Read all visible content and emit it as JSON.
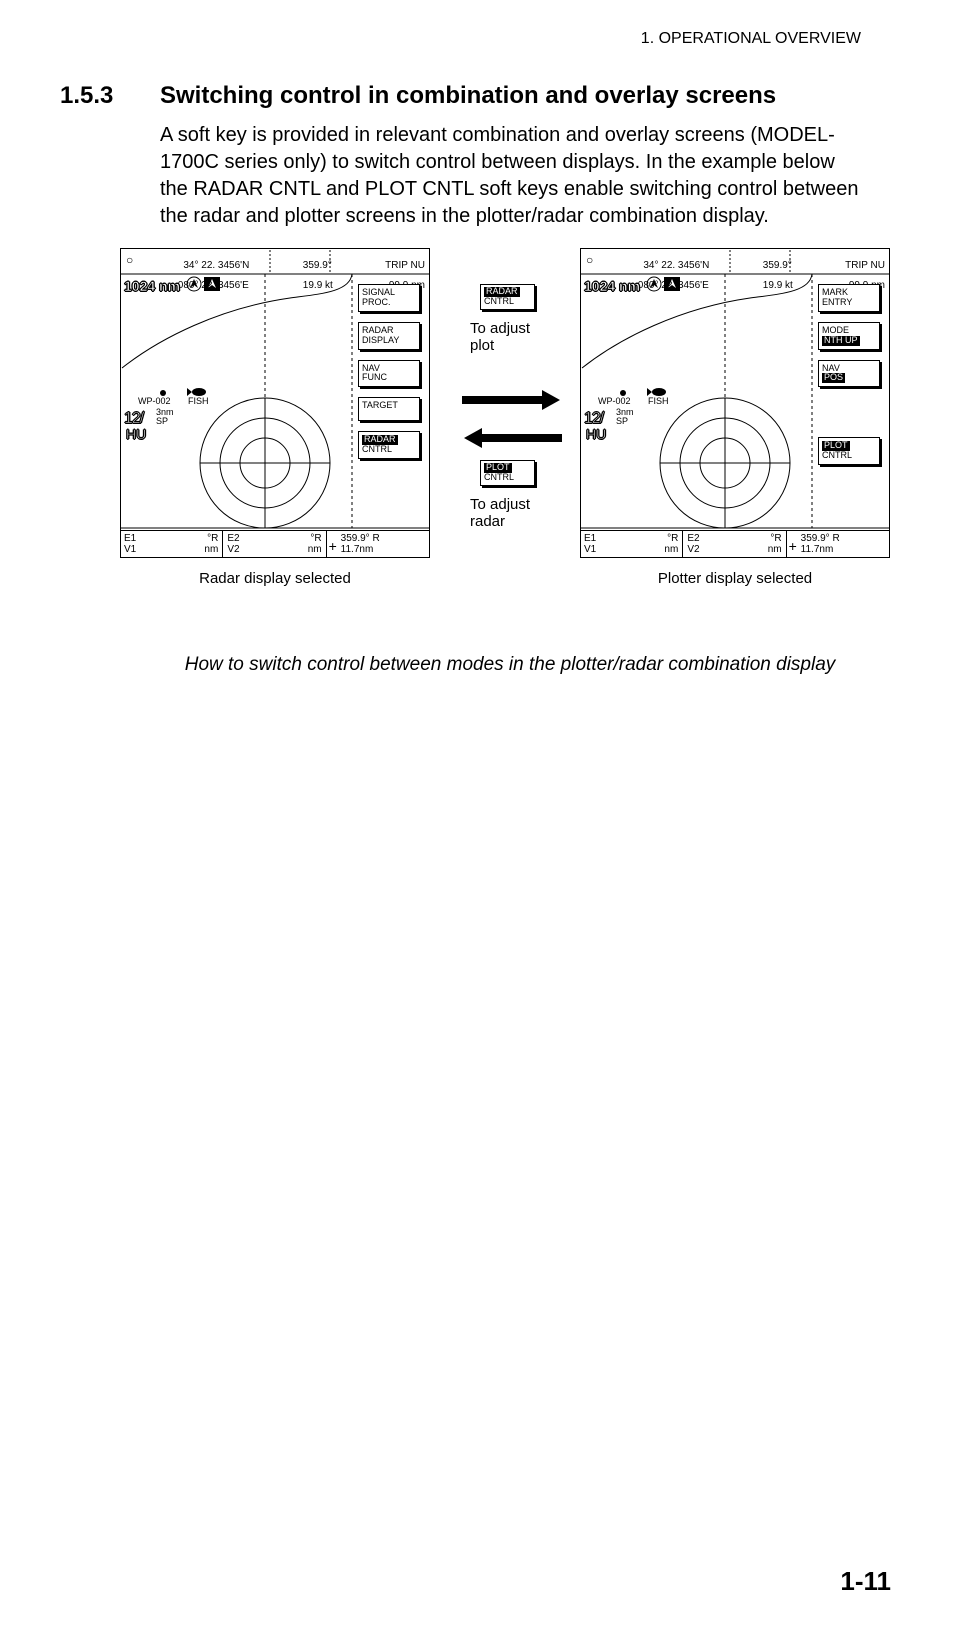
{
  "running_head": "1.  OPERATIONAL OVERVIEW",
  "section_number": "1.5.3",
  "section_title": "Switching control in combination and overlay screens",
  "body": "A soft key is provided in relevant combination and overlay screens (MODEL-1700C series only) to switch control between displays. In the example below the RADAR CNTL and PLOT CNTL soft keys enable switching control between the radar and plotter screens in the plotter/radar combination display.",
  "page_number": "1-11",
  "middle": {
    "radar_key_l1": "RADAR",
    "radar_key_l2": "CNTRL",
    "plot_key_l1": "PLOT",
    "plot_key_l2": "CNTRL",
    "adjust_plot": "To adjust\nplot",
    "adjust_radar": "To adjust\nradar"
  },
  "panel_common": {
    "circle": "○",
    "lat": "  34° 22. 3456'N",
    "lon": "080° 22. 3456'E",
    "hdg": "359.9°",
    "spd": "19.9 kt",
    "trip_lbl": "TRIP NU",
    "trip_val": "99.9 nm",
    "scale": "1024 nm",
    "wp": "WP-002",
    "fish": "FISH",
    "range_main": "12/",
    "range_sub_top": "3nm",
    "range_sub_bot": "SP",
    "hu": "HU",
    "cell1_a": "E1",
    "cell1_b": "°R",
    "cell1_c": "V1",
    "cell1_d": "nm",
    "cell2_a": "E2",
    "cell2_b": "°R",
    "cell2_c": "V2",
    "cell2_d": "nm",
    "cell3_top": "359.9° R",
    "cell3_bot": "11.7nm",
    "plus": "+"
  },
  "left_panel": {
    "caption": "Radar display selected",
    "softkeys": [
      {
        "l1": "SIGNAL",
        "l2": "PROC.",
        "inv1": false,
        "inv2": false
      },
      {
        "l1": "RADAR",
        "l2": "DISPLAY",
        "inv1": false,
        "inv2": false
      },
      {
        "l1": "NAV",
        "l2": "FUNC",
        "inv1": false,
        "inv2": false
      },
      {
        "l1": "TARGET",
        "l2": "",
        "inv1": false,
        "inv2": false
      },
      {
        "l1": "RADAR",
        "l2": "CNTRL",
        "inv1": true,
        "inv2": false
      }
    ]
  },
  "right_panel": {
    "caption": "Plotter display selected",
    "softkeys": [
      {
        "l1": "MARK",
        "l2": "ENTRY",
        "inv1": false,
        "inv2": false
      },
      {
        "l1": "MODE",
        "l2": "NTH UP",
        "inv1": false,
        "inv2": true
      },
      {
        "l1": "NAV",
        "l2": "POS",
        "inv1": false,
        "inv2": true
      },
      {
        "l1": "",
        "l2": "",
        "inv1": false,
        "inv2": false,
        "blank": true
      },
      {
        "l1": "PLOT",
        "l2": "CNTRL",
        "inv1": true,
        "inv2": false
      }
    ]
  },
  "figure_caption": "How to switch control between modes in the plotter/radar combination display"
}
